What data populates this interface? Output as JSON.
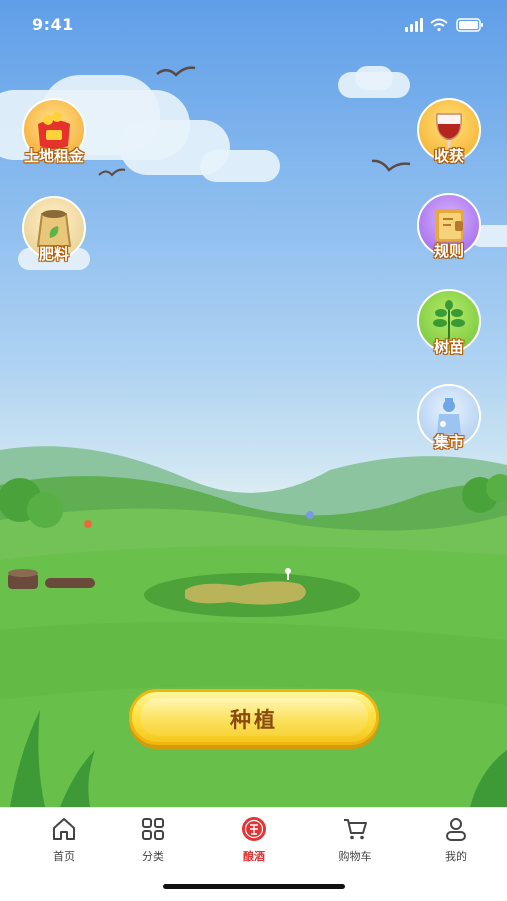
{
  "status_bar": {
    "time": "9:41"
  },
  "side_buttons": {
    "land_rent": "土地租金",
    "fertilizer": "肥料",
    "harvest": "收获",
    "rules": "规则",
    "seedlings": "树苗",
    "market": "集市"
  },
  "plant_button": {
    "label": "种植"
  },
  "tabbar": {
    "tabs": [
      {
        "label": "首页",
        "icon": "home-icon"
      },
      {
        "label": "分类",
        "icon": "grid-icon"
      },
      {
        "label": "酿酒",
        "icon": "brew-icon",
        "active": true
      },
      {
        "label": "购物车",
        "icon": "cart-icon"
      },
      {
        "label": "我的",
        "icon": "user-icon"
      }
    ]
  },
  "colors": {
    "accent": "#e23434",
    "button_gold": "#ffe246",
    "grass": "#6bc24a"
  }
}
